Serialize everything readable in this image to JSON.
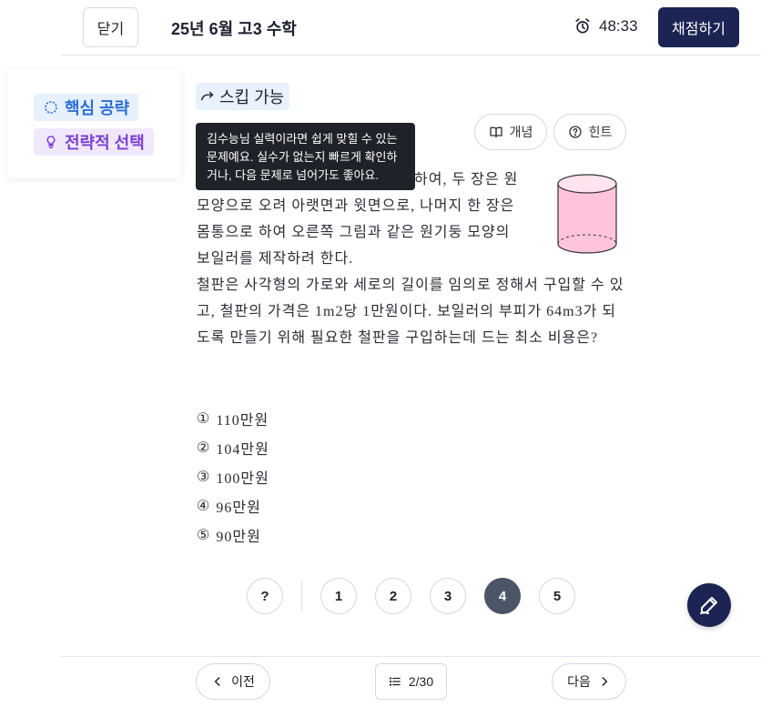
{
  "header": {
    "close_label": "닫기",
    "title": "25년 6월 고3 수학",
    "timer": "48:33",
    "grade_label": "채점하기"
  },
  "strategy": {
    "core_label": "핵심 공략",
    "choice_label": "전략적 선택"
  },
  "badge": {
    "skip_label": "스킵 가능"
  },
  "tooltip": {
    "text": "김수능님 실력이라면 쉽게 맞힐 수 있는 문제예요.  실수가 없는지 빠르게 확인하거나, 다음 문제로 넘어가도 좋아요."
  },
  "tools": {
    "concept_label": "개념",
    "hint_label": "힌트"
  },
  "question": {
    "line1": "하여, 두 장은 원",
    "line2": "모양으로 오려 아랫면과 윗면으로, 나머지 한 장은",
    "line3": "몸통으로 하여 오른쪽 그림과 같은 원기둥 모양의",
    "line4": "보일러를 제작하려 한다.",
    "para2": "철판은 사각형의 가로와 세로의 길이를 임의로 정해서 구입할 수 있고, 철판의 가격은 1m2당 1만원이다. 보일러의 부피가 64m3가 되도록 만들기 위해 필요한 철판을 구입하는데 드는 최소 비용은?"
  },
  "choices": [
    {
      "num": "①",
      "text": "110만원"
    },
    {
      "num": "②",
      "text": "104만원"
    },
    {
      "num": "③",
      "text": "100만원"
    },
    {
      "num": "④",
      "text": "96만원"
    },
    {
      "num": "⑤",
      "text": "90만원"
    }
  ],
  "qnav": {
    "unknown": "?",
    "items": [
      "1",
      "2",
      "3",
      "4",
      "5"
    ],
    "selected": "4"
  },
  "footer": {
    "prev_label": "이전",
    "page_indicator": "2/30",
    "next_label": "다음"
  },
  "colors": {
    "primary": "#1b2452",
    "core_tag_bg": "#e7f0fd",
    "core_tag_text": "#2b6fd6",
    "choice_tag_bg": "#f1e9fb",
    "choice_tag_text": "#7a3fd0",
    "active_nav": "#4a5666",
    "cylinder_fill": "#ffc4dc"
  },
  "icons": {
    "alarm": "alarm-clock-icon",
    "target": "target-icon",
    "bulb": "lightbulb-icon",
    "skip": "skip-arrow-icon",
    "book": "book-icon",
    "help": "help-circle-icon",
    "pen": "pen-icon",
    "list": "list-icon",
    "prev": "chevron-left-icon",
    "next": "chevron-right-icon"
  }
}
